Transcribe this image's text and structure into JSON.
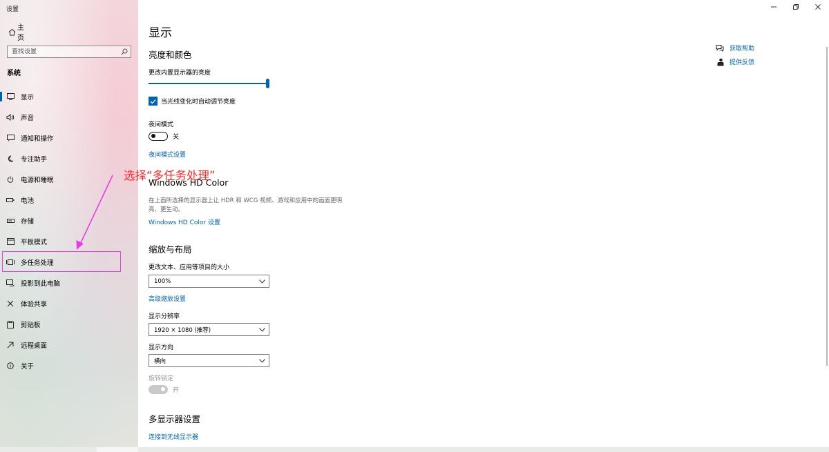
{
  "app": {
    "title": "设置"
  },
  "sidebar": {
    "home_label": "主页",
    "search_placeholder": "查找设置",
    "section_label": "系统",
    "items": [
      {
        "label": "显示",
        "icon": "monitor-icon"
      },
      {
        "label": "声音",
        "icon": "speaker-icon"
      },
      {
        "label": "通知和操作",
        "icon": "notification-icon"
      },
      {
        "label": "专注助手",
        "icon": "moon-icon"
      },
      {
        "label": "电源和睡眠",
        "icon": "power-icon"
      },
      {
        "label": "电池",
        "icon": "battery-icon"
      },
      {
        "label": "存储",
        "icon": "storage-icon"
      },
      {
        "label": "平板模式",
        "icon": "tablet-icon"
      },
      {
        "label": "多任务处理",
        "icon": "multitask-icon"
      },
      {
        "label": "投影到此电脑",
        "icon": "project-icon"
      },
      {
        "label": "体验共享",
        "icon": "share-icon"
      },
      {
        "label": "剪贴板",
        "icon": "clipboard-icon"
      },
      {
        "label": "远程桌面",
        "icon": "remote-desktop-icon"
      },
      {
        "label": "关于",
        "icon": "info-icon"
      }
    ],
    "selected_item": "显示",
    "accent_color": "#0063b1"
  },
  "main": {
    "page_title": "显示",
    "brightness": {
      "heading": "亮度和颜色",
      "slider_label": "更改内置显示器的亮度",
      "slider_value": 1.0,
      "auto_checkbox_label": "当光线变化时自动调节亮度",
      "auto_checked": true
    },
    "night": {
      "label": "夜间模式",
      "toggle_state": "关",
      "settings_link": "夜间模式设置"
    },
    "hdr": {
      "heading": "Windows HD Color",
      "description": "在上面所选择的显示器上让 HDR 和 WCG 视频、游戏和应用中的画面更明亮、更生动。",
      "settings_link": "Windows HD Color 设置"
    },
    "scale": {
      "heading": "缩放与布局",
      "scale_label": "更改文本、应用等项目的大小",
      "scale_value": "100%",
      "advanced_link": "高级缩放设置",
      "resolution_label": "显示分辨率",
      "resolution_value": "1920 × 1080 (推荐)",
      "orientation_label": "显示方向",
      "orientation_value": "横向",
      "rotation_lock_label": "旋转锁定",
      "rotation_lock_state": "开"
    },
    "multi": {
      "heading": "多显示器设置",
      "connect_link": "连接到无线显示器"
    },
    "help": {
      "get_help": "获取帮助",
      "feedback": "提供反馈"
    }
  },
  "annotation": {
    "text": "选择“多任务处理”",
    "color": "#ff2a2a",
    "arrow_color": "#e83ce6"
  }
}
